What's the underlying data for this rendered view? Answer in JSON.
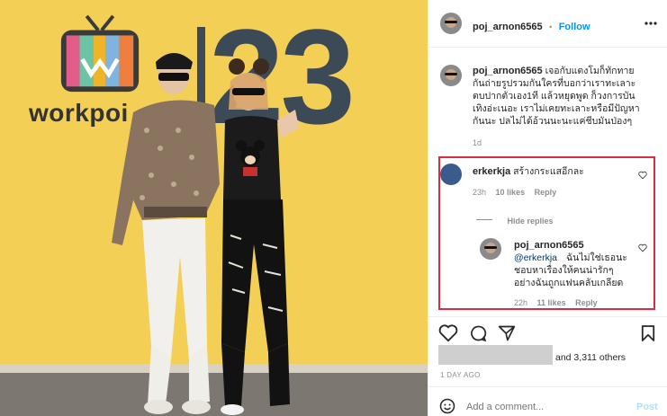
{
  "post": {
    "username": "poj_arnon6565",
    "follow_label": "Follow",
    "dot": "•",
    "caption": "เจอกับแตงโมก็ทักทายกันถ่ายรูปรวมกันใครที่บอกว่าเราทะเลาะตบปากตัวเอง1ที แล้วหยุดพูด ก็วงการบันเทิงอ่ะเนอะ เราไม่เคยทะเลาะหรือมีปัญหากันนะ ปลไม่ได้อ้วนนะนะแค่ชีบมันป่องๆ",
    "caption_time": "1d"
  },
  "photo": {
    "brand_text": "workpoi",
    "big_number": "23"
  },
  "comments": [
    {
      "username": "erkerkja",
      "text": "สร้างกระแสอีกละ",
      "time": "23h",
      "likes": "10 likes",
      "reply_label": "Reply",
      "hide_replies": "Hide replies",
      "reply": {
        "username": "poj_arnon6565",
        "mention": "@erkerkja",
        "text_line1": "ฉันไม่ใช่เธอนะ",
        "text_line2": "ชอบหาเรื่องให้คนน่ารักๆ",
        "text_line3": "อย่างฉันถูกแฟนคลับเกลียด",
        "time": "22h",
        "likes": "11 likes",
        "reply_label": "Reply"
      }
    }
  ],
  "likes_text": "and 3,311 others",
  "post_age": "1 DAY AGO",
  "add_comment_placeholder": "Add a comment...",
  "post_button": "Post",
  "colors": {
    "accent_blue": "#0095f6",
    "highlight_red": "#d92d3e",
    "photo_bg": "#f3cf55"
  },
  "icons": [
    "more-icon",
    "heart-icon",
    "comment-icon",
    "share-icon",
    "bookmark-icon",
    "emoji-icon"
  ]
}
